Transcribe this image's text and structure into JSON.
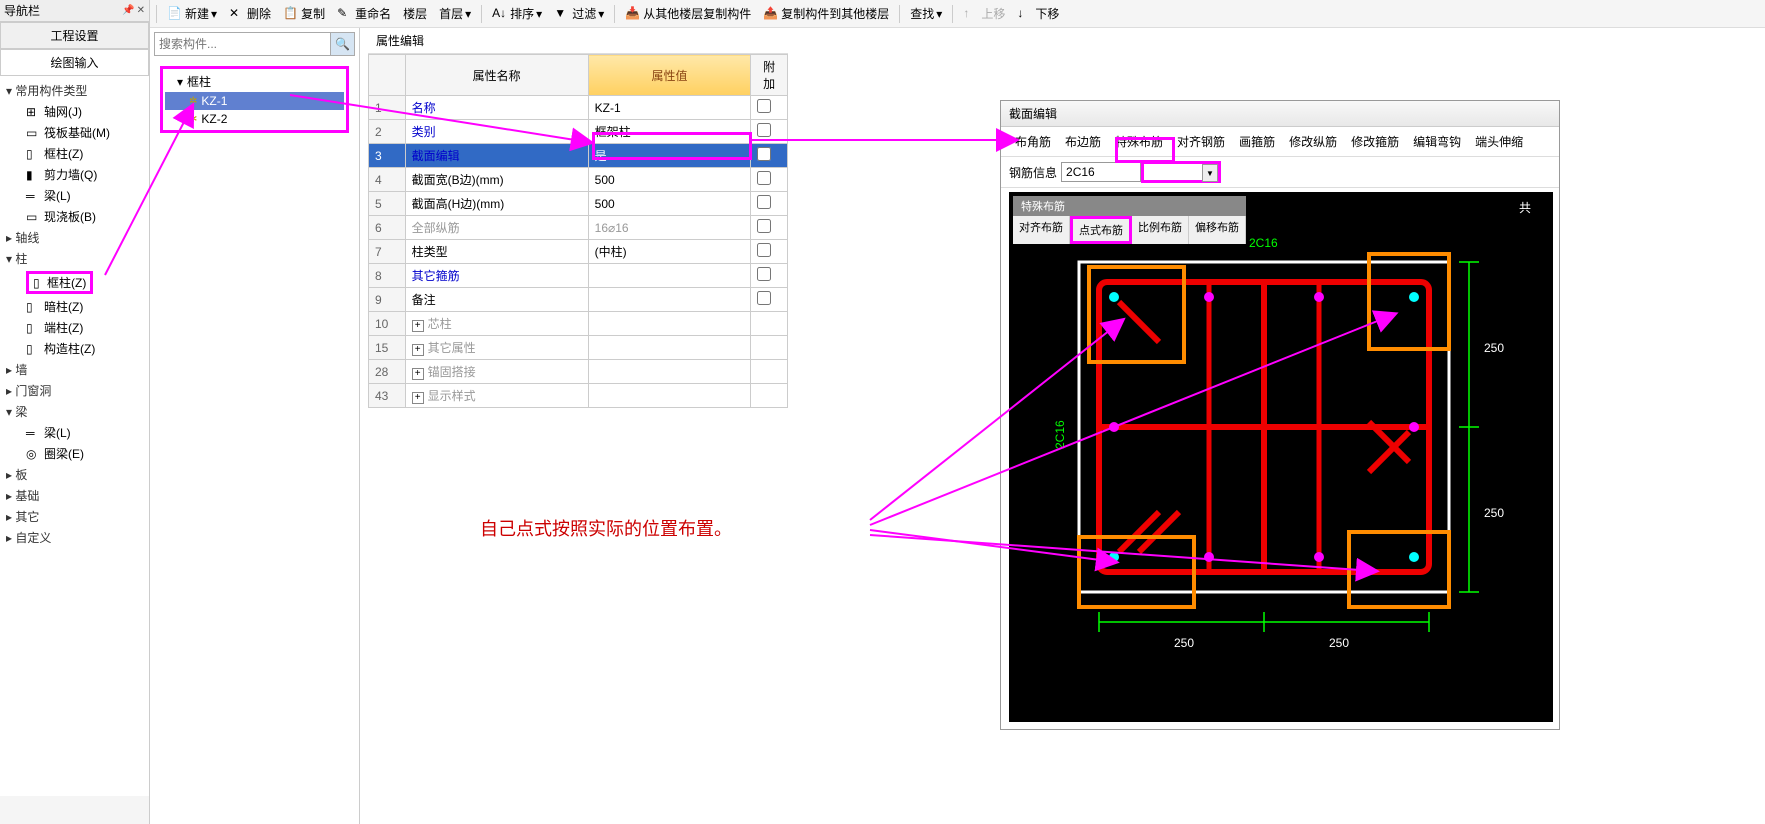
{
  "nav": {
    "title": "导航栏",
    "tabs": [
      "工程设置",
      "绘图输入"
    ],
    "groups": [
      {
        "label": "常用构件类型",
        "items": [
          {
            "label": "轴网(J)"
          },
          {
            "label": "筏板基础(M)"
          },
          {
            "label": "框柱(Z)"
          },
          {
            "label": "剪力墙(Q)"
          },
          {
            "label": "梁(L)"
          },
          {
            "label": "现浇板(B)"
          }
        ]
      },
      {
        "label": "轴线",
        "items": []
      },
      {
        "label": "柱",
        "items": [
          {
            "label": "框柱(Z)",
            "highlight": true
          },
          {
            "label": "暗柱(Z)"
          },
          {
            "label": "端柱(Z)"
          },
          {
            "label": "构造柱(Z)"
          }
        ]
      },
      {
        "label": "墙",
        "items": []
      },
      {
        "label": "门窗洞",
        "items": []
      },
      {
        "label": "梁",
        "items": [
          {
            "label": "梁(L)"
          },
          {
            "label": "圈梁(E)"
          }
        ]
      },
      {
        "label": "板",
        "items": []
      },
      {
        "label": "基础",
        "items": []
      },
      {
        "label": "其它",
        "items": []
      },
      {
        "label": "自定义",
        "items": []
      }
    ]
  },
  "toolbar": {
    "new": "新建",
    "delete": "删除",
    "copy": "复制",
    "rename": "重命名",
    "floor": "楼层",
    "first": "首层",
    "sort": "排序",
    "filter": "过滤",
    "copy_from": "从其他楼层复制构件",
    "copy_to": "复制构件到其他楼层",
    "find": "查找",
    "up": "上移",
    "down": "下移"
  },
  "search": {
    "placeholder": "搜索构件..."
  },
  "comp_tree": {
    "root": "框柱",
    "items": [
      "KZ-1",
      "KZ-2"
    ]
  },
  "props": {
    "title": "属性编辑",
    "headers": {
      "name": "属性名称",
      "val": "属性值",
      "extra": "附加"
    },
    "rows": [
      {
        "n": "1",
        "name": "名称",
        "val": "KZ-1",
        "blue": true,
        "chk": false
      },
      {
        "n": "2",
        "name": "类别",
        "val": "框架柱",
        "blue": true,
        "chk": true
      },
      {
        "n": "3",
        "name": "截面编辑",
        "val": "是",
        "blue": true,
        "sel": true,
        "chk": false
      },
      {
        "n": "4",
        "name": "截面宽(B边)(mm)",
        "val": "500",
        "chk": true
      },
      {
        "n": "5",
        "name": "截面高(H边)(mm)",
        "val": "500",
        "chk": true
      },
      {
        "n": "6",
        "name": "全部纵筋",
        "val": "16⌀16",
        "gray": true,
        "chk": true
      },
      {
        "n": "7",
        "name": "柱类型",
        "val": "(中柱)",
        "chk": true
      },
      {
        "n": "8",
        "name": "其它箍筋",
        "val": "",
        "blue": true,
        "chk": false
      },
      {
        "n": "9",
        "name": "备注",
        "val": "",
        "chk": true
      },
      {
        "n": "10",
        "name": "芯柱",
        "expand": true
      },
      {
        "n": "15",
        "name": "其它属性",
        "expand": true
      },
      {
        "n": "28",
        "name": "锚固搭接",
        "expand": true
      },
      {
        "n": "43",
        "name": "显示样式",
        "expand": true
      }
    ]
  },
  "section": {
    "title": "截面编辑",
    "tabs": [
      "布角筋",
      "布边筋",
      "特殊布筋",
      "对齐钢筋",
      "画箍筋",
      "修改纵筋",
      "修改箍筋",
      "编辑弯钩",
      "端头伸缩"
    ],
    "info_label": "钢筋信息",
    "info_val": "2C16",
    "layout_group": "特殊布筋",
    "layout_tabs": [
      "对齐布筋",
      "点式布筋",
      "比例布筋",
      "偏移布筋"
    ],
    "dims": {
      "d1": "250",
      "d2": "250",
      "d3": "250",
      "d4": "250"
    },
    "side_label1": "2C16",
    "side_label2": "2C16",
    "shared_label": "共"
  },
  "annotation": "自己点式按照实际的位置布置。"
}
